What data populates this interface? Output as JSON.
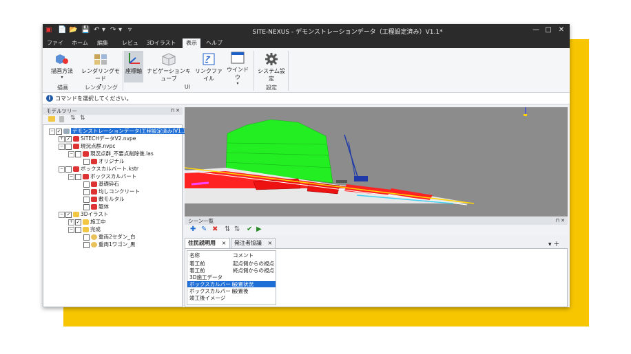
{
  "app": {
    "title": "SITE-NEXUS - デモンストレーションデータ（工程設定済み）V1.1*",
    "window_controls": [
      "—",
      "□",
      "✕"
    ],
    "quick_access": [
      "▣",
      "📄",
      "📂",
      "💾",
      "↶",
      "▾",
      "↷",
      "▾",
      "▿"
    ]
  },
  "menu_tabs": [
    "ファイル",
    "ホーム",
    "編集",
    "レビュー",
    "3Dイラスト",
    "表示",
    "ヘルプ"
  ],
  "active_tab": "表示",
  "ribbon": {
    "buttons": {
      "draw_method": "描画方法",
      "rendering_mode": "レンダリングモード",
      "axes": "座標軸",
      "nav_cube": "ナビゲーションキューブ",
      "link_file": "リンクファイル",
      "window": "ウインドウ",
      "system_settings": "システム設定"
    },
    "groups": {
      "draw": "描画",
      "rendering": "レンダリング",
      "ui": "UI",
      "settings": "設定"
    }
  },
  "command_bar": {
    "message": "コマンドを選択してください。"
  },
  "model_tree": {
    "title": "モデルツリー",
    "pin": "⊓ ✕",
    "root": "デモンストレーションデータ(工程設定済み)V1.1",
    "items": [
      "SiTECHデータV2.nvpe",
      "現況点群.nvpc",
      "現況点群_不要点削除後.las",
      "オリジナル",
      "ボックスカルバート.kstr",
      "ボックスカルバート",
      "基礎砕石",
      "均しコンクリート",
      "敷モルタル",
      "躯体",
      "3Dイラスト",
      "施工中",
      "完成",
      "重両2セダン_白",
      "重両1ワゴン_黒"
    ]
  },
  "scene_list": {
    "title": "シーン一覧",
    "pin": "⊓ ✕",
    "tabs": [
      "住民説明用",
      "発注者協議"
    ],
    "tab_close": "×",
    "right_controls": "▾ ＋",
    "headers": [
      "名称",
      "コメント"
    ],
    "rows": [
      [
        "着工前",
        "起点側からの視点"
      ],
      [
        "着工前",
        "終点側からの視点"
      ],
      [
        "3D施工データ",
        ""
      ],
      [
        "ボックスカルバート",
        "設置状況"
      ],
      [
        "ボックスカルバート",
        "設置後"
      ],
      [
        "竣工後イメージ",
        ""
      ]
    ],
    "selected_row": 3
  },
  "colors": {
    "accent": "#1f6fd6",
    "titlebar": "#2b2b2b",
    "highlight": "#f7c600"
  }
}
